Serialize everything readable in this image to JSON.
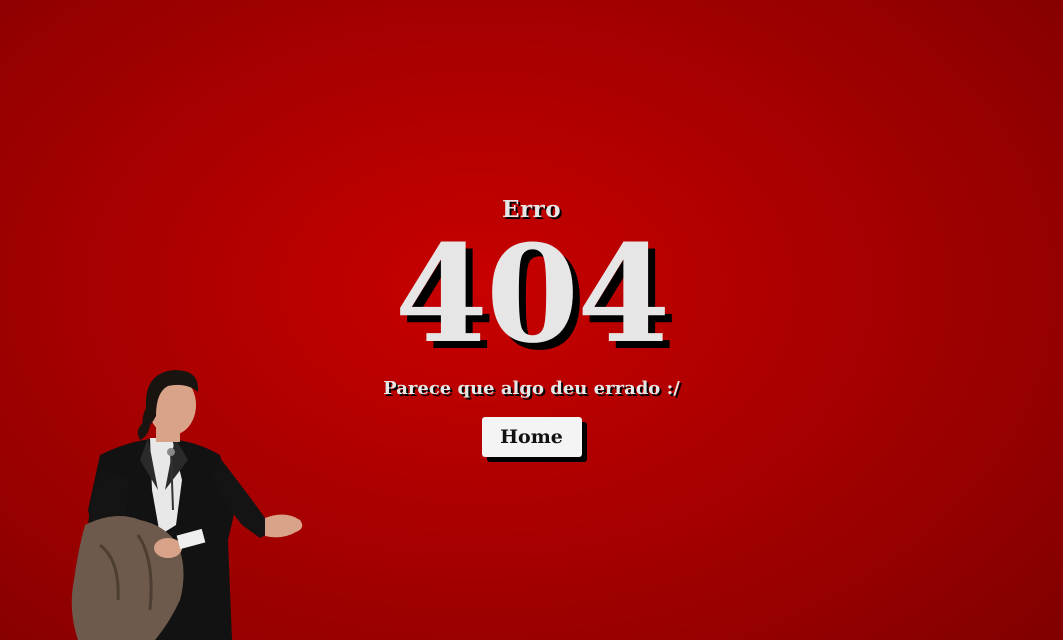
{
  "error": {
    "label": "Erro",
    "code": "404",
    "message": "Parece que algo deu errado :/"
  },
  "actions": {
    "home_label": "Home"
  },
  "colors": {
    "background": "#b00000",
    "text": "#e6e6e6",
    "shadow": "#000000",
    "button_bg": "#f4f4f4"
  },
  "illustration": {
    "icon": "confused-man-illustration"
  }
}
